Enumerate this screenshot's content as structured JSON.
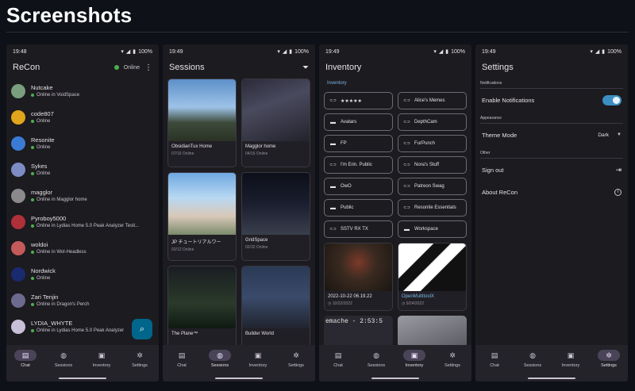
{
  "page": {
    "title": "Screenshots"
  },
  "colors": {
    "background": "#0e1117",
    "surface": "#1c1b1f",
    "accent": "#00668b",
    "online": "#4caf50",
    "link": "#7ab8e6"
  },
  "nav": {
    "chat": "Chat",
    "sessions": "Sessions",
    "inventory": "Inventory",
    "settings": "Settings"
  },
  "screens": {
    "chat": {
      "time": "19:48",
      "battery": "100%",
      "title": "ReCon",
      "status_label": "Online",
      "contacts": [
        {
          "name": "Nutcake",
          "status": "Online in VoidSpace",
          "color": "#7a9e7e"
        },
        {
          "name": "code807",
          "status": "Online",
          "color": "#e0a51a"
        },
        {
          "name": "Resonite",
          "status": "Online",
          "color": "#3a7bd5"
        },
        {
          "name": "Sykes",
          "status": "Online",
          "color": "#7d8cc4"
        },
        {
          "name": "magglor",
          "status": "Online in Magglor home",
          "color": "#8a8a8a"
        },
        {
          "name": "Pyroboy5000",
          "status": "Online in Lydias Home 5.0 Peak Analyzer Testi...",
          "color": "#b0303a"
        },
        {
          "name": "woldoi",
          "status": "Online in Wol-Headless",
          "color": "#c45a5a"
        },
        {
          "name": "Nordwick",
          "status": "Online",
          "color": "#1a2a6e"
        },
        {
          "name": "Zari Tenjin",
          "status": "Online in Dragon's Perch",
          "color": "#6d6a8f"
        },
        {
          "name": "LYDIA_WHYTE",
          "status": "Online in Lydias Home 5.0 Peak Analyzer",
          "color": "#c7c0d8"
        }
      ]
    },
    "sessions": {
      "time": "19:49",
      "battery": "100%",
      "title": "Sessions",
      "cards": [
        {
          "name": "ObsidianTux Home",
          "count": "07/16 Online",
          "thumb": "linear-gradient(180deg,#5d8fc9 0%,#9ec3e8 45%,#3d4a3a 70%,#2a3225 100%)"
        },
        {
          "name": "Magglor home",
          "count": "04/16 Online",
          "thumb": "linear-gradient(160deg,#2a2a3a 0%,#4a4a5e 40%,#23232d 100%)"
        },
        {
          "name": "JP チュートリアルワー",
          "count": "02/12 Online",
          "thumb": "linear-gradient(180deg,#6fa8e0 0%,#b8d8f2 40%,#d8c8b8 70%,#7a8a6a 100%)"
        },
        {
          "name": "GridSpace",
          "count": "02/32 Online",
          "thumb": "linear-gradient(180deg,#0d0f1a 0%,#1a1e2e 50%,#3a3f4e 100%)"
        },
        {
          "name": "The Plane™",
          "count": "",
          "thumb": "linear-gradient(180deg,#1a1d22 0%,#2a3a2a 60%,#0f1a12 100%)"
        },
        {
          "name": "Builder World",
          "count": "",
          "thumb": "linear-gradient(180deg,#2a3a55 0%,#3a4a6a 50%,#20242e 100%)"
        }
      ]
    },
    "inventory": {
      "time": "19:49",
      "battery": "100%",
      "title": "Inventory",
      "breadcrumb": "Inventory",
      "items": [
        {
          "icon": "link-icon",
          "label": "★★★★★"
        },
        {
          "icon": "link-icon",
          "label": "Alice's Memes"
        },
        {
          "icon": "folder-icon",
          "label": "Avatars"
        },
        {
          "icon": "link-icon",
          "label": "DepthCam"
        },
        {
          "icon": "folder-icon",
          "label": "FP"
        },
        {
          "icon": "link-icon",
          "label": "FurPunch"
        },
        {
          "icon": "link-icon",
          "label": "I'm Erin. Public"
        },
        {
          "icon": "link-icon",
          "label": "Nora's Stuff"
        },
        {
          "icon": "folder-icon",
          "label": "OwO"
        },
        {
          "icon": "link-icon",
          "label": "Patreon Swag"
        },
        {
          "icon": "folder-icon",
          "label": "Public"
        },
        {
          "icon": "link-icon",
          "label": "Resonite Essentials"
        },
        {
          "icon": "link-icon",
          "label": "SSTV RX TX"
        },
        {
          "icon": "folder-icon",
          "label": "Workspace"
        }
      ],
      "thumbs": [
        {
          "name": "2022-10-22 06.19.22",
          "date": "10/22/2022",
          "link": false,
          "img": "radial-gradient(circle at 50% 40%,#7a3a2a 0%,#3a2a20 40%,#1a1612 100%)"
        },
        {
          "name": "OpenMultitoolX",
          "date": "9/24/2022",
          "link": true,
          "img": "linear-gradient(135deg,#ffffff 0%,#ffffff 30%,#111111 31%,#111111 45%,#ffffff 46%,#ffffff 60%,#111111 61%,#111111 100%)"
        }
      ],
      "partial_text": "emache - 2:53:5"
    },
    "settings": {
      "time": "19:49",
      "battery": "100%",
      "title": "Settings",
      "notifications_header": "Notifications",
      "enable_notifications": "Enable Notifications",
      "appearance_header": "Appearance",
      "theme_mode": "Theme Mode",
      "theme_value": "Dark",
      "other_header": "Other",
      "sign_out": "Sign out",
      "about": "About ReCon"
    }
  }
}
